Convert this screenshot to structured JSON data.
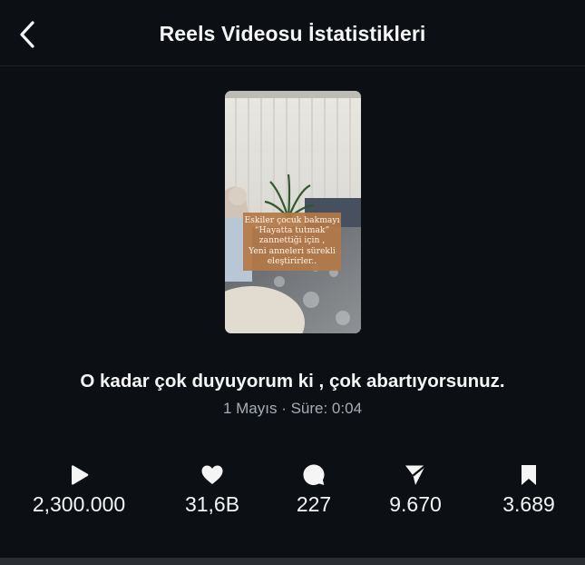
{
  "header": {
    "title": "Reels Videosu İstatistikleri",
    "back_icon": "chevron-left-icon"
  },
  "video": {
    "overlay_text": [
      "Eskiler çocuk bakmayı",
      "“Hayatta tutmak”",
      "zannettiği için ,",
      "Yeni anneleri sürekli",
      "eleştirirler.."
    ],
    "title": "O kadar çok duyuyorum ki , çok abartıyorsunuz.",
    "meta": "1 Mayıs · Süre: 0:04"
  },
  "stats": [
    {
      "icon": "play-icon",
      "value": "2,300.000"
    },
    {
      "icon": "heart-icon",
      "value": "31,6B"
    },
    {
      "icon": "comment-icon",
      "value": "227"
    },
    {
      "icon": "share-icon",
      "value": "9.670"
    },
    {
      "icon": "bookmark-icon",
      "value": "3.689"
    }
  ],
  "colors": {
    "background": "#0c1014",
    "text": "#f5f5f5",
    "secondary_text": "#a8adb3",
    "caption_box": "#b47846"
  }
}
